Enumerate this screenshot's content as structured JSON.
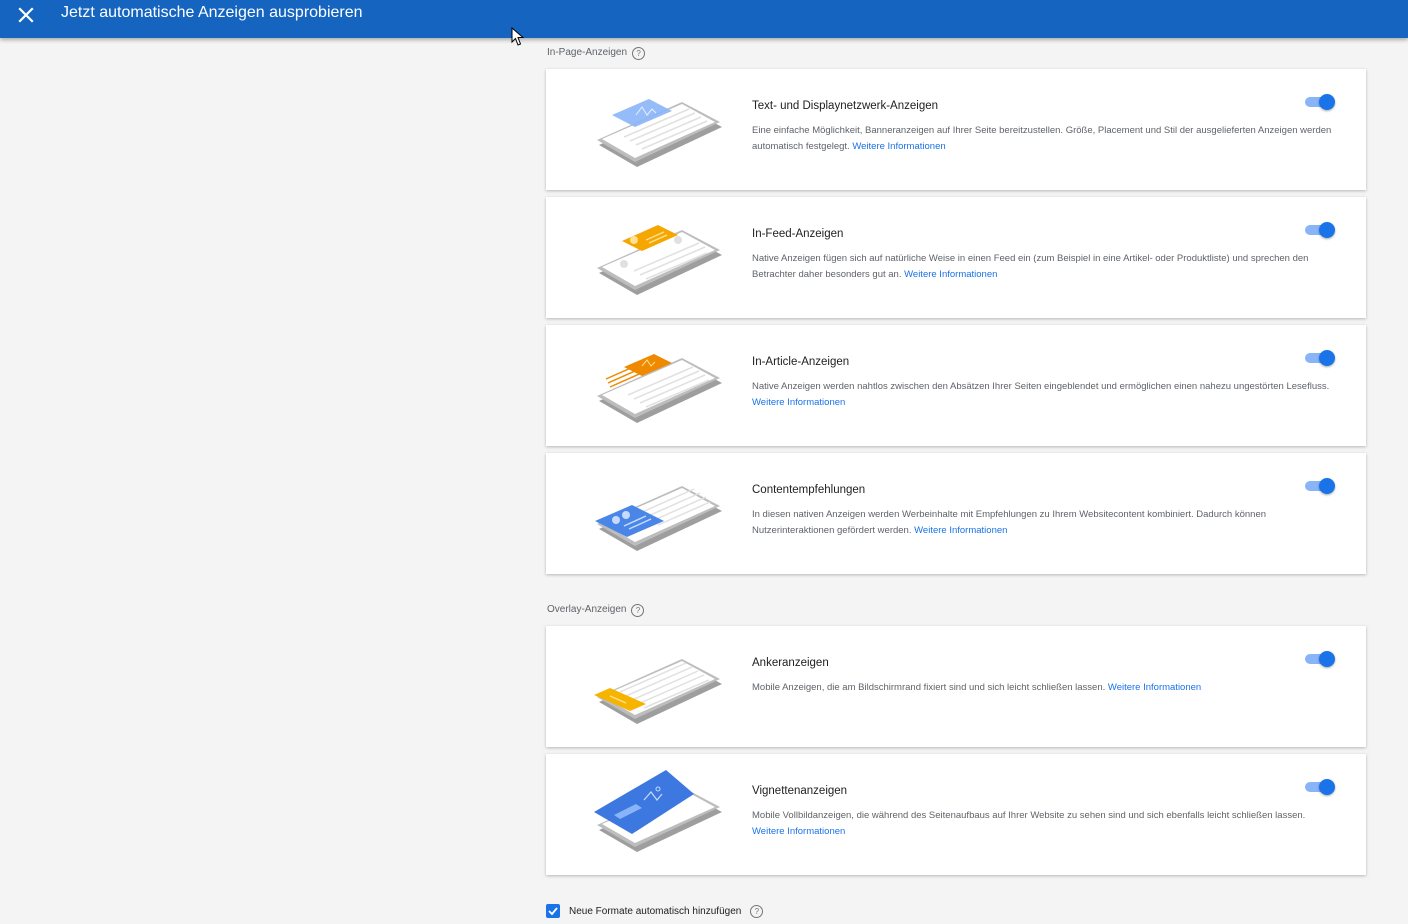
{
  "header": {
    "title": "Jetzt automatische Anzeigen ausprobieren",
    "close_icon": "close-icon"
  },
  "sections": {
    "in_page": {
      "label": "In-Page-Anzeigen",
      "help_symbol": "?"
    },
    "overlay": {
      "label": "Overlay-Anzeigen",
      "help_symbol": "?"
    }
  },
  "cards": [
    {
      "title": "Text- und Displaynetzwerk-Anzeigen",
      "description": "Eine einfache Möglichkeit, Banneranzeigen auf Ihrer Seite bereitzustellen. Größe, Placement und Stil der ausgelieferten Anzeigen werden automatisch festgelegt.",
      "link": "Weitere Informationen",
      "enabled": true,
      "accent": "#8ab4f8"
    },
    {
      "title": "In-Feed-Anzeigen",
      "description": "Native Anzeigen fügen sich auf natürliche Weise in einen Feed ein (zum Beispiel in eine Artikel- oder Produktliste) und sprechen den Betrachter daher besonders gut an.",
      "link": "Weitere Informationen",
      "enabled": true,
      "accent": "#f6a600"
    },
    {
      "title": "In-Article-Anzeigen",
      "description": "Native Anzeigen werden nahtlos zwischen den Absätzen Ihrer Seiten eingeblendet und ermöglichen einen nahezu ungestörten Lesefluss.",
      "link": "Weitere Informationen",
      "enabled": true,
      "accent": "#ef8a00"
    },
    {
      "title": "Contentempfehlungen",
      "description": "In diesen nativen Anzeigen werden Werbeinhalte mit Empfehlungen zu Ihrem Websitecontent kombiniert. Dadurch können Nutzerinteraktionen gefördert werden.",
      "link": "Weitere Informationen",
      "enabled": true,
      "accent": "#4a86e8"
    },
    {
      "title": "Ankeranzeigen",
      "description": "Mobile Anzeigen, die am Bildschirmrand fixiert sind und sich leicht schließen lassen.",
      "link": "Weitere Informationen",
      "enabled": true,
      "accent": "#f6b400"
    },
    {
      "title": "Vignettenanzeigen",
      "description": "Mobile Vollbildanzeigen, die während des Seitenaufbaus auf Ihrer Website zu sehen sind und sich ebenfalls leicht schließen lassen.",
      "link": "Weitere Informationen",
      "enabled": true,
      "accent": "#3c78e0"
    }
  ],
  "footer": {
    "checkbox_label": "Neue Formate automatisch hinzufügen",
    "checked": true,
    "help_symbol": "?"
  },
  "colors": {
    "header_bg": "#1565c0",
    "toggle_on": "#1a73e8",
    "link": "#1a73e8"
  }
}
